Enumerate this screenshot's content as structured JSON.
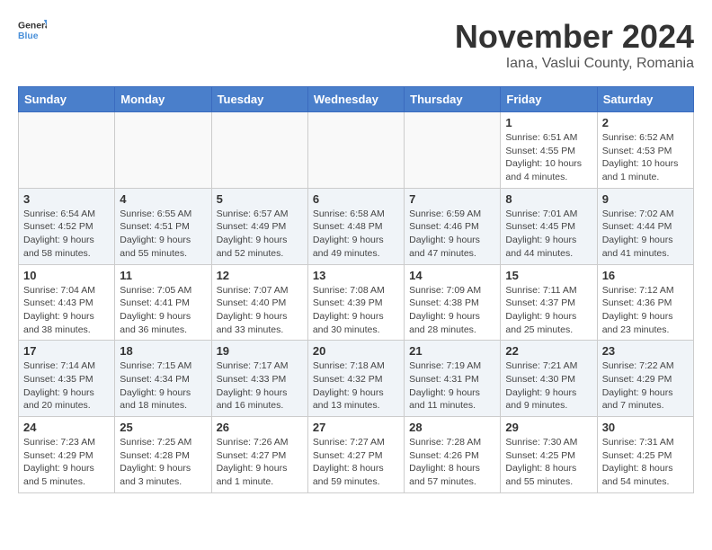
{
  "header": {
    "logo_general": "General",
    "logo_blue": "Blue",
    "month_title": "November 2024",
    "subtitle": "Iana, Vaslui County, Romania"
  },
  "days_of_week": [
    "Sunday",
    "Monday",
    "Tuesday",
    "Wednesday",
    "Thursday",
    "Friday",
    "Saturday"
  ],
  "weeks": [
    [
      {
        "day": "",
        "info": ""
      },
      {
        "day": "",
        "info": ""
      },
      {
        "day": "",
        "info": ""
      },
      {
        "day": "",
        "info": ""
      },
      {
        "day": "",
        "info": ""
      },
      {
        "day": "1",
        "info": "Sunrise: 6:51 AM\nSunset: 4:55 PM\nDaylight: 10 hours and 4 minutes."
      },
      {
        "day": "2",
        "info": "Sunrise: 6:52 AM\nSunset: 4:53 PM\nDaylight: 10 hours and 1 minute."
      }
    ],
    [
      {
        "day": "3",
        "info": "Sunrise: 6:54 AM\nSunset: 4:52 PM\nDaylight: 9 hours and 58 minutes."
      },
      {
        "day": "4",
        "info": "Sunrise: 6:55 AM\nSunset: 4:51 PM\nDaylight: 9 hours and 55 minutes."
      },
      {
        "day": "5",
        "info": "Sunrise: 6:57 AM\nSunset: 4:49 PM\nDaylight: 9 hours and 52 minutes."
      },
      {
        "day": "6",
        "info": "Sunrise: 6:58 AM\nSunset: 4:48 PM\nDaylight: 9 hours and 49 minutes."
      },
      {
        "day": "7",
        "info": "Sunrise: 6:59 AM\nSunset: 4:46 PM\nDaylight: 9 hours and 47 minutes."
      },
      {
        "day": "8",
        "info": "Sunrise: 7:01 AM\nSunset: 4:45 PM\nDaylight: 9 hours and 44 minutes."
      },
      {
        "day": "9",
        "info": "Sunrise: 7:02 AM\nSunset: 4:44 PM\nDaylight: 9 hours and 41 minutes."
      }
    ],
    [
      {
        "day": "10",
        "info": "Sunrise: 7:04 AM\nSunset: 4:43 PM\nDaylight: 9 hours and 38 minutes."
      },
      {
        "day": "11",
        "info": "Sunrise: 7:05 AM\nSunset: 4:41 PM\nDaylight: 9 hours and 36 minutes."
      },
      {
        "day": "12",
        "info": "Sunrise: 7:07 AM\nSunset: 4:40 PM\nDaylight: 9 hours and 33 minutes."
      },
      {
        "day": "13",
        "info": "Sunrise: 7:08 AM\nSunset: 4:39 PM\nDaylight: 9 hours and 30 minutes."
      },
      {
        "day": "14",
        "info": "Sunrise: 7:09 AM\nSunset: 4:38 PM\nDaylight: 9 hours and 28 minutes."
      },
      {
        "day": "15",
        "info": "Sunrise: 7:11 AM\nSunset: 4:37 PM\nDaylight: 9 hours and 25 minutes."
      },
      {
        "day": "16",
        "info": "Sunrise: 7:12 AM\nSunset: 4:36 PM\nDaylight: 9 hours and 23 minutes."
      }
    ],
    [
      {
        "day": "17",
        "info": "Sunrise: 7:14 AM\nSunset: 4:35 PM\nDaylight: 9 hours and 20 minutes."
      },
      {
        "day": "18",
        "info": "Sunrise: 7:15 AM\nSunset: 4:34 PM\nDaylight: 9 hours and 18 minutes."
      },
      {
        "day": "19",
        "info": "Sunrise: 7:17 AM\nSunset: 4:33 PM\nDaylight: 9 hours and 16 minutes."
      },
      {
        "day": "20",
        "info": "Sunrise: 7:18 AM\nSunset: 4:32 PM\nDaylight: 9 hours and 13 minutes."
      },
      {
        "day": "21",
        "info": "Sunrise: 7:19 AM\nSunset: 4:31 PM\nDaylight: 9 hours and 11 minutes."
      },
      {
        "day": "22",
        "info": "Sunrise: 7:21 AM\nSunset: 4:30 PM\nDaylight: 9 hours and 9 minutes."
      },
      {
        "day": "23",
        "info": "Sunrise: 7:22 AM\nSunset: 4:29 PM\nDaylight: 9 hours and 7 minutes."
      }
    ],
    [
      {
        "day": "24",
        "info": "Sunrise: 7:23 AM\nSunset: 4:29 PM\nDaylight: 9 hours and 5 minutes."
      },
      {
        "day": "25",
        "info": "Sunrise: 7:25 AM\nSunset: 4:28 PM\nDaylight: 9 hours and 3 minutes."
      },
      {
        "day": "26",
        "info": "Sunrise: 7:26 AM\nSunset: 4:27 PM\nDaylight: 9 hours and 1 minute."
      },
      {
        "day": "27",
        "info": "Sunrise: 7:27 AM\nSunset: 4:27 PM\nDaylight: 8 hours and 59 minutes."
      },
      {
        "day": "28",
        "info": "Sunrise: 7:28 AM\nSunset: 4:26 PM\nDaylight: 8 hours and 57 minutes."
      },
      {
        "day": "29",
        "info": "Sunrise: 7:30 AM\nSunset: 4:25 PM\nDaylight: 8 hours and 55 minutes."
      },
      {
        "day": "30",
        "info": "Sunrise: 7:31 AM\nSunset: 4:25 PM\nDaylight: 8 hours and 54 minutes."
      }
    ]
  ]
}
